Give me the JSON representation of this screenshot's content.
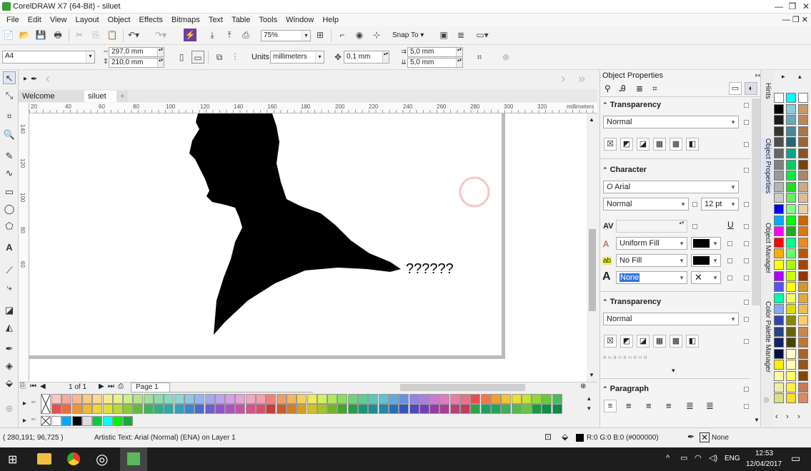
{
  "app": {
    "title": "CorelDRAW X7 (64-Bit) - siluet",
    "min": "—",
    "max": "❐",
    "close": "✕"
  },
  "menu": [
    "File",
    "Edit",
    "View",
    "Layout",
    "Object",
    "Effects",
    "Bitmaps",
    "Text",
    "Table",
    "Tools",
    "Window",
    "Help"
  ],
  "standard_toolbar": {
    "zoom": "75%",
    "snap_to": "Snap To"
  },
  "property_bar": {
    "page_size": "A4",
    "width": "297,0 mm",
    "height": "210,0 mm",
    "units_label": "Units:",
    "units": "millimeters",
    "nudge": "0,1 mm",
    "dup_x": "5,0 mm",
    "dup_y": "5,0 mm"
  },
  "doc_tabs": [
    "Welcome Screen",
    "siluet"
  ],
  "ruler": {
    "units": "millimeters",
    "h_ticks": [
      "20",
      "40",
      "60",
      "80",
      "100",
      "120",
      "140",
      "160",
      "180",
      "200",
      "220",
      "240",
      "260",
      "280",
      "300",
      "320"
    ],
    "v_ticks": [
      "140",
      "120",
      "100",
      "80",
      "60"
    ]
  },
  "canvas": {
    "text": "??????"
  },
  "page_nav": {
    "page_of": "1 of 1",
    "page_tab": "Page 1"
  },
  "status": {
    "coords": "( 280,191; 96,725 )",
    "info": "Artistic Text: Arial (Normal) (ENA) on Layer 1",
    "fill": "R:0 G:0 B:0 (#000000)",
    "outline": "None"
  },
  "props": {
    "title": "Object Properties",
    "transparency_label": "Transparency",
    "transparency_mode": "Normal",
    "character_label": "Character",
    "font": "Arial",
    "font_style": "Normal",
    "font_size": "12 pt",
    "fill_type": "Uniform Fill",
    "bg_fill": "No Fill",
    "outline": "None",
    "transparency2_label": "Transparency",
    "transparency2_mode": "Normal",
    "paragraph_label": "Paragraph"
  },
  "side_tabs": [
    "Hints",
    "Object Properties",
    "Object Manager",
    "Color Palette Manager"
  ],
  "taskbar": {
    "lang": "ENG",
    "time": "12:53",
    "date": "12/04/2017"
  },
  "colors": {
    "palette_row1": [
      "#f7c6c6",
      "#f4a9a3",
      "#f7b98e",
      "#f8c98a",
      "#f8dc8a",
      "#f5ec8c",
      "#e7f28c",
      "#cdee8c",
      "#b3e68c",
      "#9fe09a",
      "#8fdcaa",
      "#8ad9c0",
      "#8dd7d5",
      "#8fc8e5",
      "#95b7ee",
      "#a6a8ee",
      "#bca3ec",
      "#d4a1e6",
      "#e8a3d7",
      "#f0a7c4",
      "#f49fb0",
      "#f47f7f",
      "#f39a6a",
      "#f5b65f",
      "#f6d15e",
      "#f2ea5e",
      "#d6ef5f",
      "#b2e65f",
      "#8ddb62",
      "#6ed27a",
      "#5ccd99",
      "#5bc9b8",
      "#5fc3d0",
      "#62a9e0",
      "#6b8fe6",
      "#8c83e4",
      "#ad7cdf",
      "#cc7ad6",
      "#e17cc2",
      "#ea7ca8",
      "#ee6e84",
      "#e94c4c",
      "#ef7c3d",
      "#f3a033",
      "#f3c332",
      "#e8e032",
      "#c2e433",
      "#92d836",
      "#64c93c",
      "#46bd5e"
    ],
    "palette_row2": [
      "#e65050",
      "#ea6e3f",
      "#ef9437",
      "#f0b735",
      "#efd535",
      "#dfe034",
      "#bbd935",
      "#8ccb37",
      "#5fbd3d",
      "#43b25c",
      "#34ac84",
      "#31a8a5",
      "#34a0be",
      "#3b87cc",
      "#476bd0",
      "#6a5fcc",
      "#8c56c6",
      "#ab52bc",
      "#c352a7",
      "#d2548a",
      "#d94f6e",
      "#c83c3c",
      "#cd5a2c",
      "#d27e24",
      "#d4a222",
      "#d0c223",
      "#a6c424",
      "#74b528",
      "#44a52f",
      "#2c9a4d",
      "#1f9372",
      "#1d8f92",
      "#1f88ab",
      "#2670b9",
      "#3356bd",
      "#5249ba",
      "#7340b3",
      "#933caa",
      "#ac3d94",
      "#bb3f77",
      "#c43a5a",
      "#2ea34a",
      "#1fa05c",
      "#25a45f",
      "#3fae5b",
      "#53b950",
      "#69c444",
      "#1a9a40",
      "#108e42",
      "#0b8a48"
    ],
    "palette_row3": [
      "#ffffff",
      "#00aaff",
      "#000000",
      "#dddddd",
      "#00cc44",
      "#00ffff",
      "#00ee00",
      "#1aa83a"
    ],
    "right_col1": [
      "#ffffff",
      "#000000",
      "#1a1a1a",
      "#333333",
      "#4d4d4d",
      "#666666",
      "#808080",
      "#999999",
      "#b3b3b3",
      "#cccccc",
      "#0000ff",
      "#00aaff",
      "#ff00ff",
      "#ff0000",
      "#ffaa00",
      "#ffff00",
      "#aa00ff",
      "#5555ff",
      "#00ffaa",
      "#88aaee",
      "#3344aa",
      "#224488",
      "#112266",
      "#001144",
      "#ffee00",
      "#ffffaa",
      "#eeeeaa",
      "#dddd88"
    ],
    "right_col2": [
      "#00ffff",
      "#88ccdd",
      "#66aabb",
      "#448899",
      "#226677",
      "#00aa88",
      "#00cc66",
      "#00ee44",
      "#22dd22",
      "#66ee66",
      "#88ff88",
      "#00ff00",
      "#22aa22",
      "#00ff88",
      "#66ff66",
      "#aaff00",
      "#ccff00",
      "#ffff00",
      "#eeff66",
      "#dddd00",
      "#888800",
      "#666600",
      "#444400",
      "#ffffcc",
      "#ffffaa",
      "#ffff66",
      "#ffee44",
      "#ffdd22"
    ],
    "right_col3": [
      "#ffffff",
      "#cc9966",
      "#bb8855",
      "#aa7744",
      "#996633",
      "#885522",
      "#774411",
      "#aa8866",
      "#ccaa88",
      "#ddbb99",
      "#eeccaa",
      "#cc6600",
      "#dd7711",
      "#ee8822",
      "#bb5500",
      "#aa4400",
      "#993300",
      "#cc9933",
      "#ddaa44",
      "#eebb55",
      "#ffcc66",
      "#cc8844",
      "#bb7733",
      "#aa6622",
      "#995511",
      "#884400",
      "#cc7755",
      "#dd8866"
    ]
  }
}
